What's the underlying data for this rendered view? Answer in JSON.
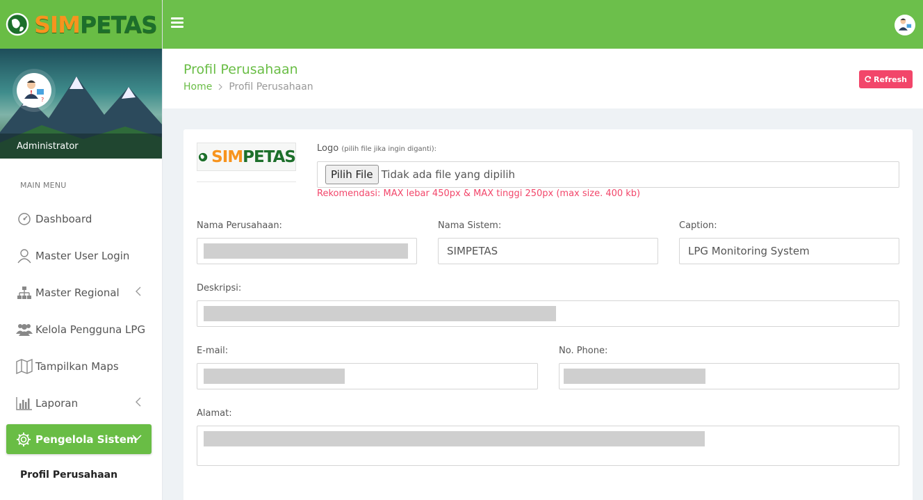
{
  "brand": {
    "part1": "SIM",
    "part2": "PETAS"
  },
  "sidebar": {
    "user_name": "Administrator",
    "menu_header": "MAIN MENU",
    "items": [
      {
        "label": "Dashboard",
        "icon": "dashboard-icon"
      },
      {
        "label": "Master User Login",
        "icon": "user-icon"
      },
      {
        "label": "Master Regional",
        "icon": "sitemap-icon"
      },
      {
        "label": "Kelola Pengguna LPG",
        "icon": "users-icon"
      },
      {
        "label": "Tampilkan Maps",
        "icon": "map-icon"
      },
      {
        "label": "Laporan",
        "icon": "bar-chart-icon"
      }
    ],
    "active_item": {
      "label": "Pengelola Sistem",
      "icon": "gear-icon"
    },
    "submenu": [
      "Profil Perusahaan"
    ]
  },
  "page": {
    "title": "Profil Perusahaan",
    "breadcrumb": {
      "home": "Home",
      "current": "Profil Perusahaan"
    },
    "refresh_label": "Refresh"
  },
  "form": {
    "logo_label": "Logo",
    "logo_hint": "(pilih file jika ingin diganti):",
    "file_button": "Pilih File",
    "file_status": "Tidak ada file yang dipilih",
    "recommendation": "Rekomendasi: MAX lebar 450px & MAX tinggi 250px (max size. 400 kb)",
    "nama_perusahaan_label": "Nama Perusahaan:",
    "nama_sistem_label": "Nama Sistem:",
    "nama_sistem_value": "SIMPETAS",
    "caption_label": "Caption:",
    "caption_value": "LPG Monitoring System",
    "deskripsi_label": "Deskripsi:",
    "email_label": "E-mail:",
    "phone_label": "No. Phone:",
    "alamat_label": "Alamat:"
  },
  "colors": {
    "primary": "#6cbf4b",
    "danger": "#f2466a",
    "brand_orange": "#f7941e",
    "brand_green": "#1d6f2b"
  }
}
